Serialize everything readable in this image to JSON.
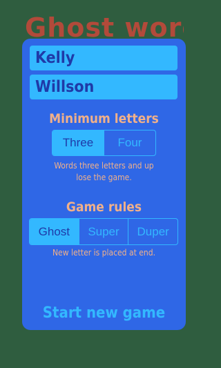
{
  "background": {
    "title_text": "Ghost word",
    "color": "#2f5d3f",
    "title_color": "#b24a3a"
  },
  "panel": {
    "color": "#2f67e6"
  },
  "players": {
    "player1": "Kelly",
    "player2": "Willson"
  },
  "minimum_letters": {
    "heading": "Minimum letters",
    "options": [
      "Three",
      "Four"
    ],
    "selected": "Three",
    "description_lines": [
      "Words three letters and up",
      "lose the game."
    ]
  },
  "game_rules": {
    "heading": "Game rules",
    "options": [
      "Ghost",
      "Super",
      "Duper"
    ],
    "selected": "Ghost",
    "description": "New letter is placed at end."
  },
  "actions": {
    "start_label": "Start new game"
  },
  "colors": {
    "accent": "#33b8ff",
    "text_dark": "#1f3aa8",
    "label_peach": "#f0b08a"
  }
}
